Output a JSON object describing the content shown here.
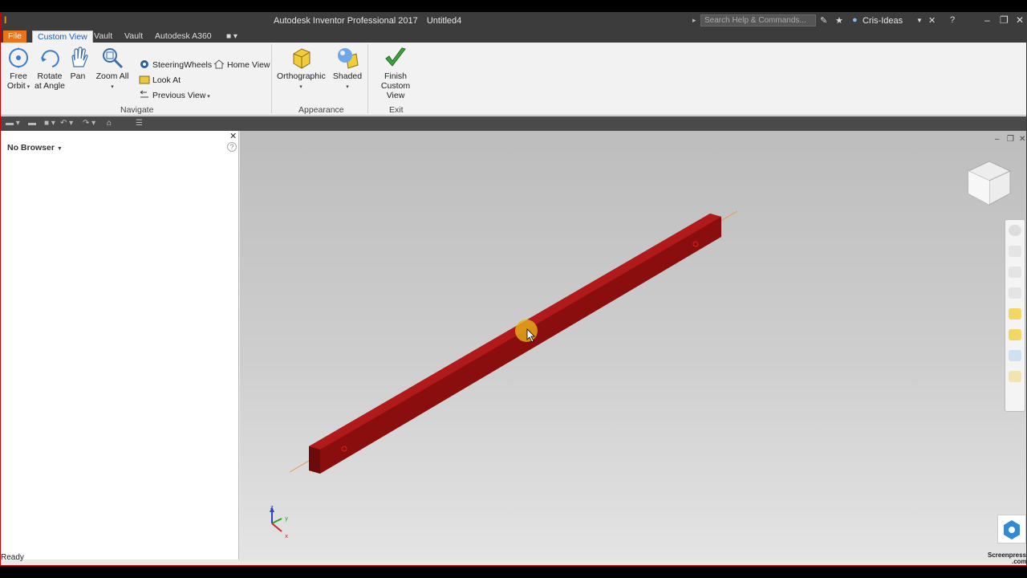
{
  "window": {
    "title": "Autodesk Inventor Professional 2017",
    "document": "Untitled4",
    "search_placeholder": "Search Help & Commands...",
    "user": "Cris-Ideas"
  },
  "tabs": {
    "file": "File",
    "custom_view": "Custom View",
    "vault1": "Vault",
    "vault2": "Vault",
    "a360": "Autodesk A360"
  },
  "ribbon": {
    "free_orbit": "Free\nOrbit",
    "free_orbit_l1": "Free",
    "free_orbit_l2": "Orbit",
    "rotate_l1": "Rotate",
    "rotate_l2": "at Angle",
    "pan": "Pan",
    "zoom_all": "Zoom All",
    "steering_wheels": "SteeringWheels",
    "look_at": "Look At",
    "previous_view": "Previous View",
    "home_view": "Home View",
    "orthographic": "Orthographic",
    "shaded": "Shaded",
    "finish_l1": "Finish Custom",
    "finish_l2": "View",
    "navigate_group": "Navigate",
    "appearance_group": "Appearance",
    "exit_group": "Exit"
  },
  "browser": {
    "title": "No Browser"
  },
  "status": {
    "text": "Ready",
    "watermark_l1": "Screenpresso",
    "watermark_l2": ".com"
  },
  "colors": {
    "accent": "#e8741c",
    "beam": "#a01010",
    "active_tab_text": "#1a5fb4"
  }
}
